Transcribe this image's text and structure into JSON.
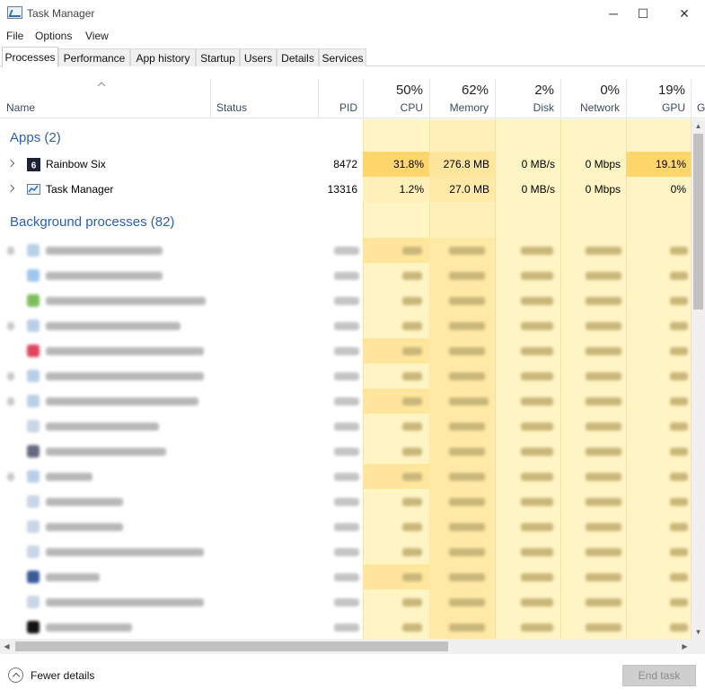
{
  "window": {
    "title": "Task Manager",
    "minimize": "─",
    "maximize": "☐",
    "close": "✕"
  },
  "menu": [
    "File",
    "Options",
    "View"
  ],
  "tabs": [
    "Processes",
    "Performance",
    "App history",
    "Startup",
    "Users",
    "Details",
    "Services"
  ],
  "columns": {
    "name": "Name",
    "status": "Status",
    "pid": "PID",
    "cpu": {
      "pct": "50%",
      "label": "CPU"
    },
    "memory": {
      "pct": "62%",
      "label": "Memory"
    },
    "disk": {
      "pct": "2%",
      "label": "Disk"
    },
    "network": {
      "pct": "0%",
      "label": "Network"
    },
    "gpu": {
      "pct": "19%",
      "label": "GPU"
    },
    "gpu_engine_partial": "G"
  },
  "groups": {
    "apps": "Apps (2)",
    "background": "Background processes (82)"
  },
  "apps": [
    {
      "name": "Rainbow Six",
      "pid": "8472",
      "cpu": "31.8%",
      "memory": "276.8 MB",
      "disk": "0 MB/s",
      "network": "0 Mbps",
      "gpu": "19.1%",
      "icon": "rainbow-six-icon"
    },
    {
      "name": "Task Manager",
      "pid": "13316",
      "cpu": "1.2%",
      "memory": "27.0 MB",
      "disk": "0 MB/s",
      "network": "0 Mbps",
      "gpu": "0%",
      "icon": "task-manager-icon"
    }
  ],
  "footer": {
    "fewer_details": "Fewer details",
    "end_task": "End task"
  },
  "colors": {
    "group": "#2a60b6",
    "heat_light": "#fff4c4",
    "heat_mid": "#ffe9a6",
    "heat_high": "#ffd66b"
  }
}
